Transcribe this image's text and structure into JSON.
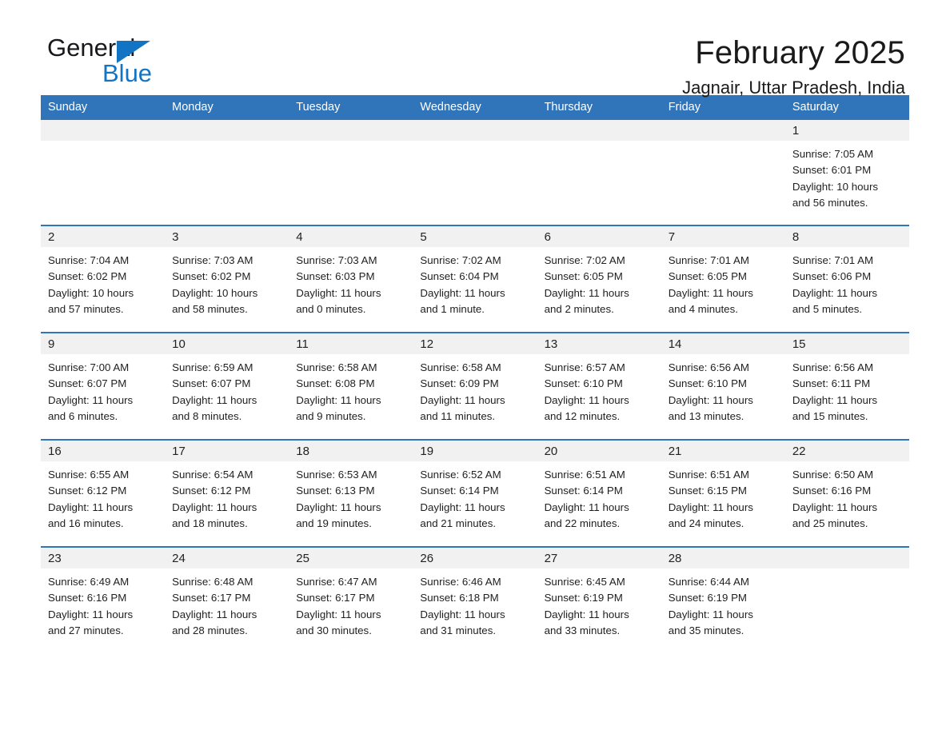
{
  "brand": {
    "word1": "General",
    "word2": "Blue",
    "accent_color": "#1474c4"
  },
  "header": {
    "title": "February 2025",
    "subtitle": "Jagnair, Uttar Pradesh, India"
  },
  "theme": {
    "header_bg": "#3075ba",
    "daynum_bg": "#f1f1f1",
    "row_border": "#3075ba"
  },
  "calendar": {
    "weekday_headers": [
      "Sunday",
      "Monday",
      "Tuesday",
      "Wednesday",
      "Thursday",
      "Friday",
      "Saturday"
    ],
    "weeks": [
      [
        {
          "day": "",
          "lines": []
        },
        {
          "day": "",
          "lines": []
        },
        {
          "day": "",
          "lines": []
        },
        {
          "day": "",
          "lines": []
        },
        {
          "day": "",
          "lines": []
        },
        {
          "day": "",
          "lines": []
        },
        {
          "day": "1",
          "lines": [
            "Sunrise: 7:05 AM",
            "Sunset: 6:01 PM",
            "Daylight: 10 hours",
            "and 56 minutes."
          ]
        }
      ],
      [
        {
          "day": "2",
          "lines": [
            "Sunrise: 7:04 AM",
            "Sunset: 6:02 PM",
            "Daylight: 10 hours",
            "and 57 minutes."
          ]
        },
        {
          "day": "3",
          "lines": [
            "Sunrise: 7:03 AM",
            "Sunset: 6:02 PM",
            "Daylight: 10 hours",
            "and 58 minutes."
          ]
        },
        {
          "day": "4",
          "lines": [
            "Sunrise: 7:03 AM",
            "Sunset: 6:03 PM",
            "Daylight: 11 hours",
            "and 0 minutes."
          ]
        },
        {
          "day": "5",
          "lines": [
            "Sunrise: 7:02 AM",
            "Sunset: 6:04 PM",
            "Daylight: 11 hours",
            "and 1 minute."
          ]
        },
        {
          "day": "6",
          "lines": [
            "Sunrise: 7:02 AM",
            "Sunset: 6:05 PM",
            "Daylight: 11 hours",
            "and 2 minutes."
          ]
        },
        {
          "day": "7",
          "lines": [
            "Sunrise: 7:01 AM",
            "Sunset: 6:05 PM",
            "Daylight: 11 hours",
            "and 4 minutes."
          ]
        },
        {
          "day": "8",
          "lines": [
            "Sunrise: 7:01 AM",
            "Sunset: 6:06 PM",
            "Daylight: 11 hours",
            "and 5 minutes."
          ]
        }
      ],
      [
        {
          "day": "9",
          "lines": [
            "Sunrise: 7:00 AM",
            "Sunset: 6:07 PM",
            "Daylight: 11 hours",
            "and 6 minutes."
          ]
        },
        {
          "day": "10",
          "lines": [
            "Sunrise: 6:59 AM",
            "Sunset: 6:07 PM",
            "Daylight: 11 hours",
            "and 8 minutes."
          ]
        },
        {
          "day": "11",
          "lines": [
            "Sunrise: 6:58 AM",
            "Sunset: 6:08 PM",
            "Daylight: 11 hours",
            "and 9 minutes."
          ]
        },
        {
          "day": "12",
          "lines": [
            "Sunrise: 6:58 AM",
            "Sunset: 6:09 PM",
            "Daylight: 11 hours",
            "and 11 minutes."
          ]
        },
        {
          "day": "13",
          "lines": [
            "Sunrise: 6:57 AM",
            "Sunset: 6:10 PM",
            "Daylight: 11 hours",
            "and 12 minutes."
          ]
        },
        {
          "day": "14",
          "lines": [
            "Sunrise: 6:56 AM",
            "Sunset: 6:10 PM",
            "Daylight: 11 hours",
            "and 13 minutes."
          ]
        },
        {
          "day": "15",
          "lines": [
            "Sunrise: 6:56 AM",
            "Sunset: 6:11 PM",
            "Daylight: 11 hours",
            "and 15 minutes."
          ]
        }
      ],
      [
        {
          "day": "16",
          "lines": [
            "Sunrise: 6:55 AM",
            "Sunset: 6:12 PM",
            "Daylight: 11 hours",
            "and 16 minutes."
          ]
        },
        {
          "day": "17",
          "lines": [
            "Sunrise: 6:54 AM",
            "Sunset: 6:12 PM",
            "Daylight: 11 hours",
            "and 18 minutes."
          ]
        },
        {
          "day": "18",
          "lines": [
            "Sunrise: 6:53 AM",
            "Sunset: 6:13 PM",
            "Daylight: 11 hours",
            "and 19 minutes."
          ]
        },
        {
          "day": "19",
          "lines": [
            "Sunrise: 6:52 AM",
            "Sunset: 6:14 PM",
            "Daylight: 11 hours",
            "and 21 minutes."
          ]
        },
        {
          "day": "20",
          "lines": [
            "Sunrise: 6:51 AM",
            "Sunset: 6:14 PM",
            "Daylight: 11 hours",
            "and 22 minutes."
          ]
        },
        {
          "day": "21",
          "lines": [
            "Sunrise: 6:51 AM",
            "Sunset: 6:15 PM",
            "Daylight: 11 hours",
            "and 24 minutes."
          ]
        },
        {
          "day": "22",
          "lines": [
            "Sunrise: 6:50 AM",
            "Sunset: 6:16 PM",
            "Daylight: 11 hours",
            "and 25 minutes."
          ]
        }
      ],
      [
        {
          "day": "23",
          "lines": [
            "Sunrise: 6:49 AM",
            "Sunset: 6:16 PM",
            "Daylight: 11 hours",
            "and 27 minutes."
          ]
        },
        {
          "day": "24",
          "lines": [
            "Sunrise: 6:48 AM",
            "Sunset: 6:17 PM",
            "Daylight: 11 hours",
            "and 28 minutes."
          ]
        },
        {
          "day": "25",
          "lines": [
            "Sunrise: 6:47 AM",
            "Sunset: 6:17 PM",
            "Daylight: 11 hours",
            "and 30 minutes."
          ]
        },
        {
          "day": "26",
          "lines": [
            "Sunrise: 6:46 AM",
            "Sunset: 6:18 PM",
            "Daylight: 11 hours",
            "and 31 minutes."
          ]
        },
        {
          "day": "27",
          "lines": [
            "Sunrise: 6:45 AM",
            "Sunset: 6:19 PM",
            "Daylight: 11 hours",
            "and 33 minutes."
          ]
        },
        {
          "day": "28",
          "lines": [
            "Sunrise: 6:44 AM",
            "Sunset: 6:19 PM",
            "Daylight: 11 hours",
            "and 35 minutes."
          ]
        },
        {
          "day": "",
          "lines": []
        }
      ]
    ]
  }
}
